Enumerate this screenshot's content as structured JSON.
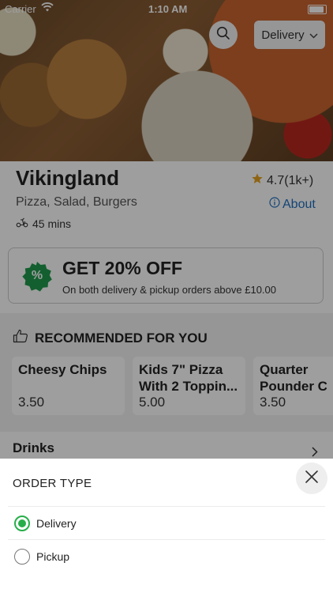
{
  "status_bar": {
    "carrier": "Carrier",
    "time": "1:10 AM"
  },
  "header": {
    "order_type_button": "Delivery"
  },
  "restaurant": {
    "name": "Vikingland",
    "rating": "4.7(1k+)",
    "cuisines": "Pizza, Salad, Burgers",
    "about_link": "About",
    "delivery_time": "45 mins"
  },
  "offer": {
    "badge_symbol": "%",
    "title": "GET 20% OFF",
    "subtitle": "On both delivery & pickup orders above £10.00",
    "badge_color": "#1f9a4c"
  },
  "recommended": {
    "heading": "RECOMMENDED FOR YOU",
    "items": [
      {
        "name_line1": "Cheesy Chips",
        "name_line2": "",
        "price": "3.50"
      },
      {
        "name_line1": "Kids 7\" Pizza",
        "name_line2": "With 2 Toppin...",
        "price": "5.00"
      },
      {
        "name_line1": "Quarter",
        "name_line2": "Pounder Ch",
        "price": "3.50"
      }
    ]
  },
  "categories": {
    "first": "Drinks"
  },
  "order_type_sheet": {
    "title": "ORDER TYPE",
    "options": [
      {
        "label": "Delivery",
        "selected": true
      },
      {
        "label": "Pickup",
        "selected": false
      }
    ],
    "accent_color": "#27ae4a"
  }
}
